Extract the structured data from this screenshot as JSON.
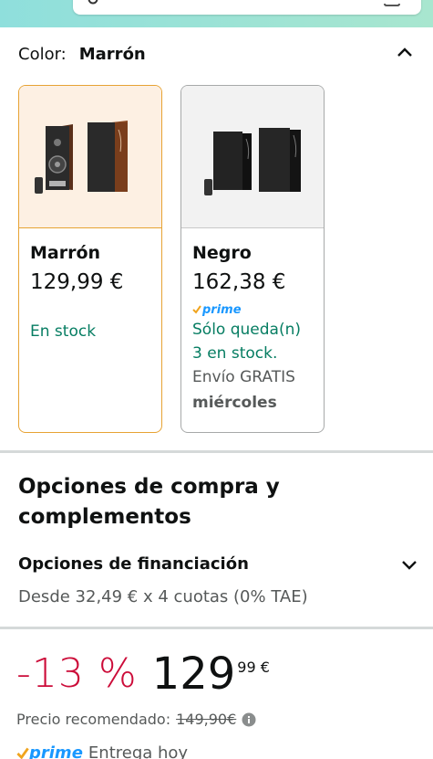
{
  "colors": {
    "accent": "#e7a334",
    "in_stock": "#067d62",
    "discount": "#cc0c39",
    "prime": "#1a98ff"
  },
  "color_selector": {
    "label": "Color:",
    "selected": "Marrón"
  },
  "variants": [
    {
      "name": "Marrón",
      "price": "129,99 €",
      "stock": "En stock",
      "selected": true
    },
    {
      "name": "Negro",
      "price": "162,38 €",
      "prime": "prime",
      "stock_line1": "Sólo queda(n)",
      "stock_line2": "3 en stock.",
      "shipping": "Envío GRATIS",
      "day": "miércoles",
      "selected": false
    }
  ],
  "section": {
    "title_line1": "Opciones de compra y",
    "title_line2": "complementos"
  },
  "financing": {
    "title": "Opciones de financiación",
    "subtitle": "Desde 32,49 € x 4 cuotas (0% TAE)"
  },
  "pricing": {
    "discount": "-13 %",
    "price_whole": "129",
    "price_cents": "99 €",
    "list_label": "Precio recomendado:",
    "list_price": "149,90€"
  },
  "delivery": {
    "prime": "prime",
    "text": "Entrega hoy"
  },
  "icons": [
    "search-icon",
    "camera-icon",
    "chevron-up-icon",
    "chevron-down-icon",
    "info-icon",
    "prime-check-icon"
  ]
}
